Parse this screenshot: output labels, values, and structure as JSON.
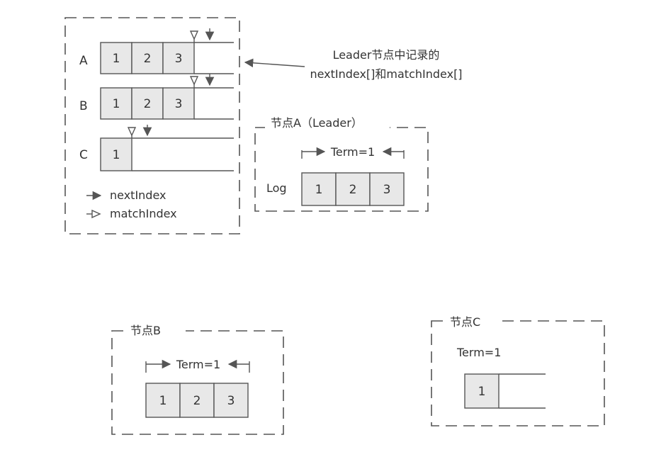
{
  "annotation": {
    "line1": "Leader节点中记录的",
    "line2": "nextIndex[]和matchIndex[]"
  },
  "index_table": {
    "rows": [
      {
        "label": "A",
        "entries": [
          "1",
          "2",
          "3"
        ]
      },
      {
        "label": "B",
        "entries": [
          "1",
          "2",
          "3"
        ]
      },
      {
        "label": "C",
        "entries": [
          "1"
        ]
      }
    ],
    "legend": {
      "next": "nextIndex",
      "match": "matchIndex"
    }
  },
  "nodes": {
    "a": {
      "title": "节点A（Leader）",
      "term": "Term=1",
      "log_label": "Log",
      "entries": [
        "1",
        "2",
        "3"
      ]
    },
    "b": {
      "title": "节点B",
      "term": "Term=1",
      "entries": [
        "1",
        "2",
        "3"
      ]
    },
    "c": {
      "title": "节点C",
      "term": "Term=1",
      "entries": [
        "1"
      ]
    }
  },
  "colors": {
    "cell_fill": "#e8e8e8",
    "stroke": "#555555",
    "text": "#333333"
  }
}
